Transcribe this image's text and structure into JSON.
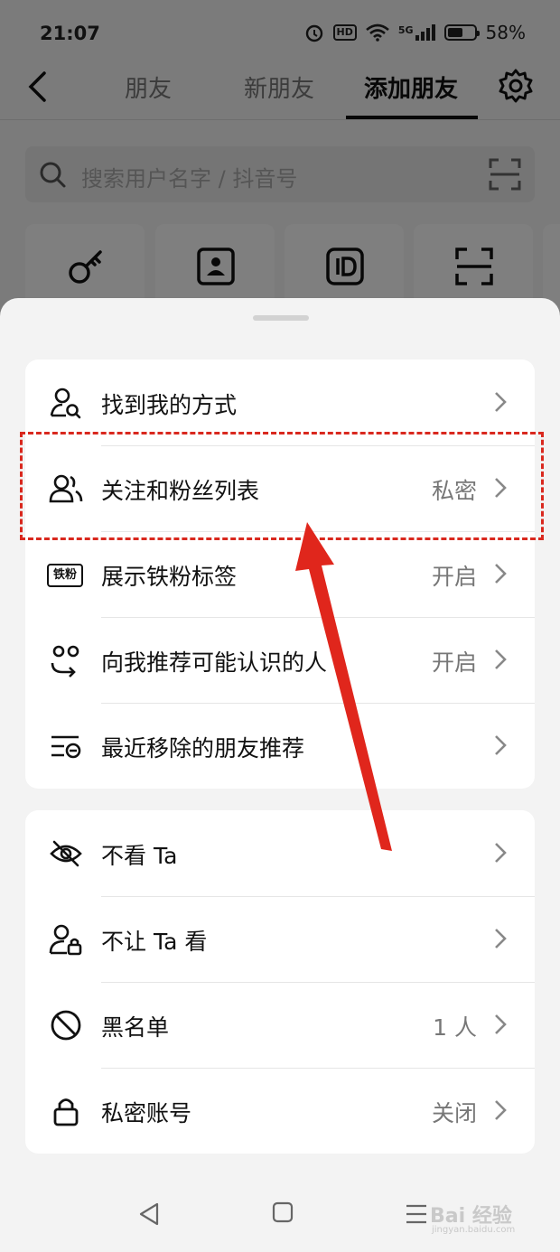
{
  "status_bar": {
    "time": "21:07",
    "hd": "HD",
    "network": "5G",
    "battery_percent": "58%",
    "battery_level": 0.58
  },
  "top_nav": {
    "tabs": [
      {
        "label": "朋友"
      },
      {
        "label": "新朋友"
      },
      {
        "label": "添加朋友"
      }
    ],
    "active_tab": "添加朋友"
  },
  "search": {
    "placeholder": "搜索用户名字 / 抖音号"
  },
  "quick_actions": [
    "key-icon",
    "contact-card-icon",
    "id-icon",
    "scan-icon"
  ],
  "sheet": {
    "group1": [
      {
        "label": "找到我的方式",
        "value": "",
        "icon": "find-me-icon"
      },
      {
        "label": "关注和粉丝列表",
        "value": "私密",
        "icon": "followers-icon"
      },
      {
        "label": "展示铁粉标签",
        "value": "开启",
        "icon": "tiefen-badge-icon",
        "badge": "铁粉"
      },
      {
        "label": "向我推荐可能认识的人",
        "value": "开启",
        "icon": "recommend-icon"
      },
      {
        "label": "最近移除的朋友推荐",
        "value": "",
        "icon": "removed-list-icon"
      }
    ],
    "group2": [
      {
        "label": "不看 Ta",
        "value": "",
        "icon": "eye-off-icon"
      },
      {
        "label": "不让 Ta 看",
        "value": "",
        "icon": "user-lock-icon"
      },
      {
        "label": "黑名单",
        "value": "1 人",
        "icon": "block-icon"
      },
      {
        "label": "私密账号",
        "value": "关闭",
        "icon": "lock-icon"
      }
    ]
  },
  "watermark": {
    "text": "Bai 经验",
    "sub": "jingyan.baidu.com"
  },
  "colors": {
    "highlight": "#d9281e",
    "arrow": "#e0261c",
    "overlay": "rgba(0,0,0,0.5)"
  }
}
